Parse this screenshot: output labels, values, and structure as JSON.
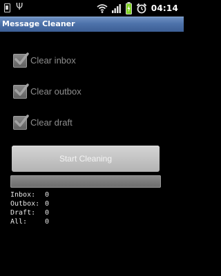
{
  "status_bar": {
    "time": "04:14",
    "icons": [
      "sim-icon",
      "usb-icon",
      "wifi-icon",
      "signal-icon",
      "battery-icon",
      "alarm-icon"
    ]
  },
  "app": {
    "title": "Message Cleaner"
  },
  "options": [
    {
      "label": "Clear inbox",
      "checked": true
    },
    {
      "label": "Clear outbox",
      "checked": true
    },
    {
      "label": "Clear draft",
      "checked": true
    }
  ],
  "start_button": {
    "label": "Start Cleaning"
  },
  "progress": {
    "value": 0
  },
  "stats": [
    {
      "label": "Inbox:",
      "value": "0"
    },
    {
      "label": "Outbox:",
      "value": "0"
    },
    {
      "label": "Draft:",
      "value": "0"
    },
    {
      "label": "All:",
      "value": "0"
    }
  ],
  "colors": {
    "title_bar": "#4d72aa",
    "background": "#000000",
    "checkbox_check": "#9a9a9a",
    "battery": "#7ed321"
  }
}
